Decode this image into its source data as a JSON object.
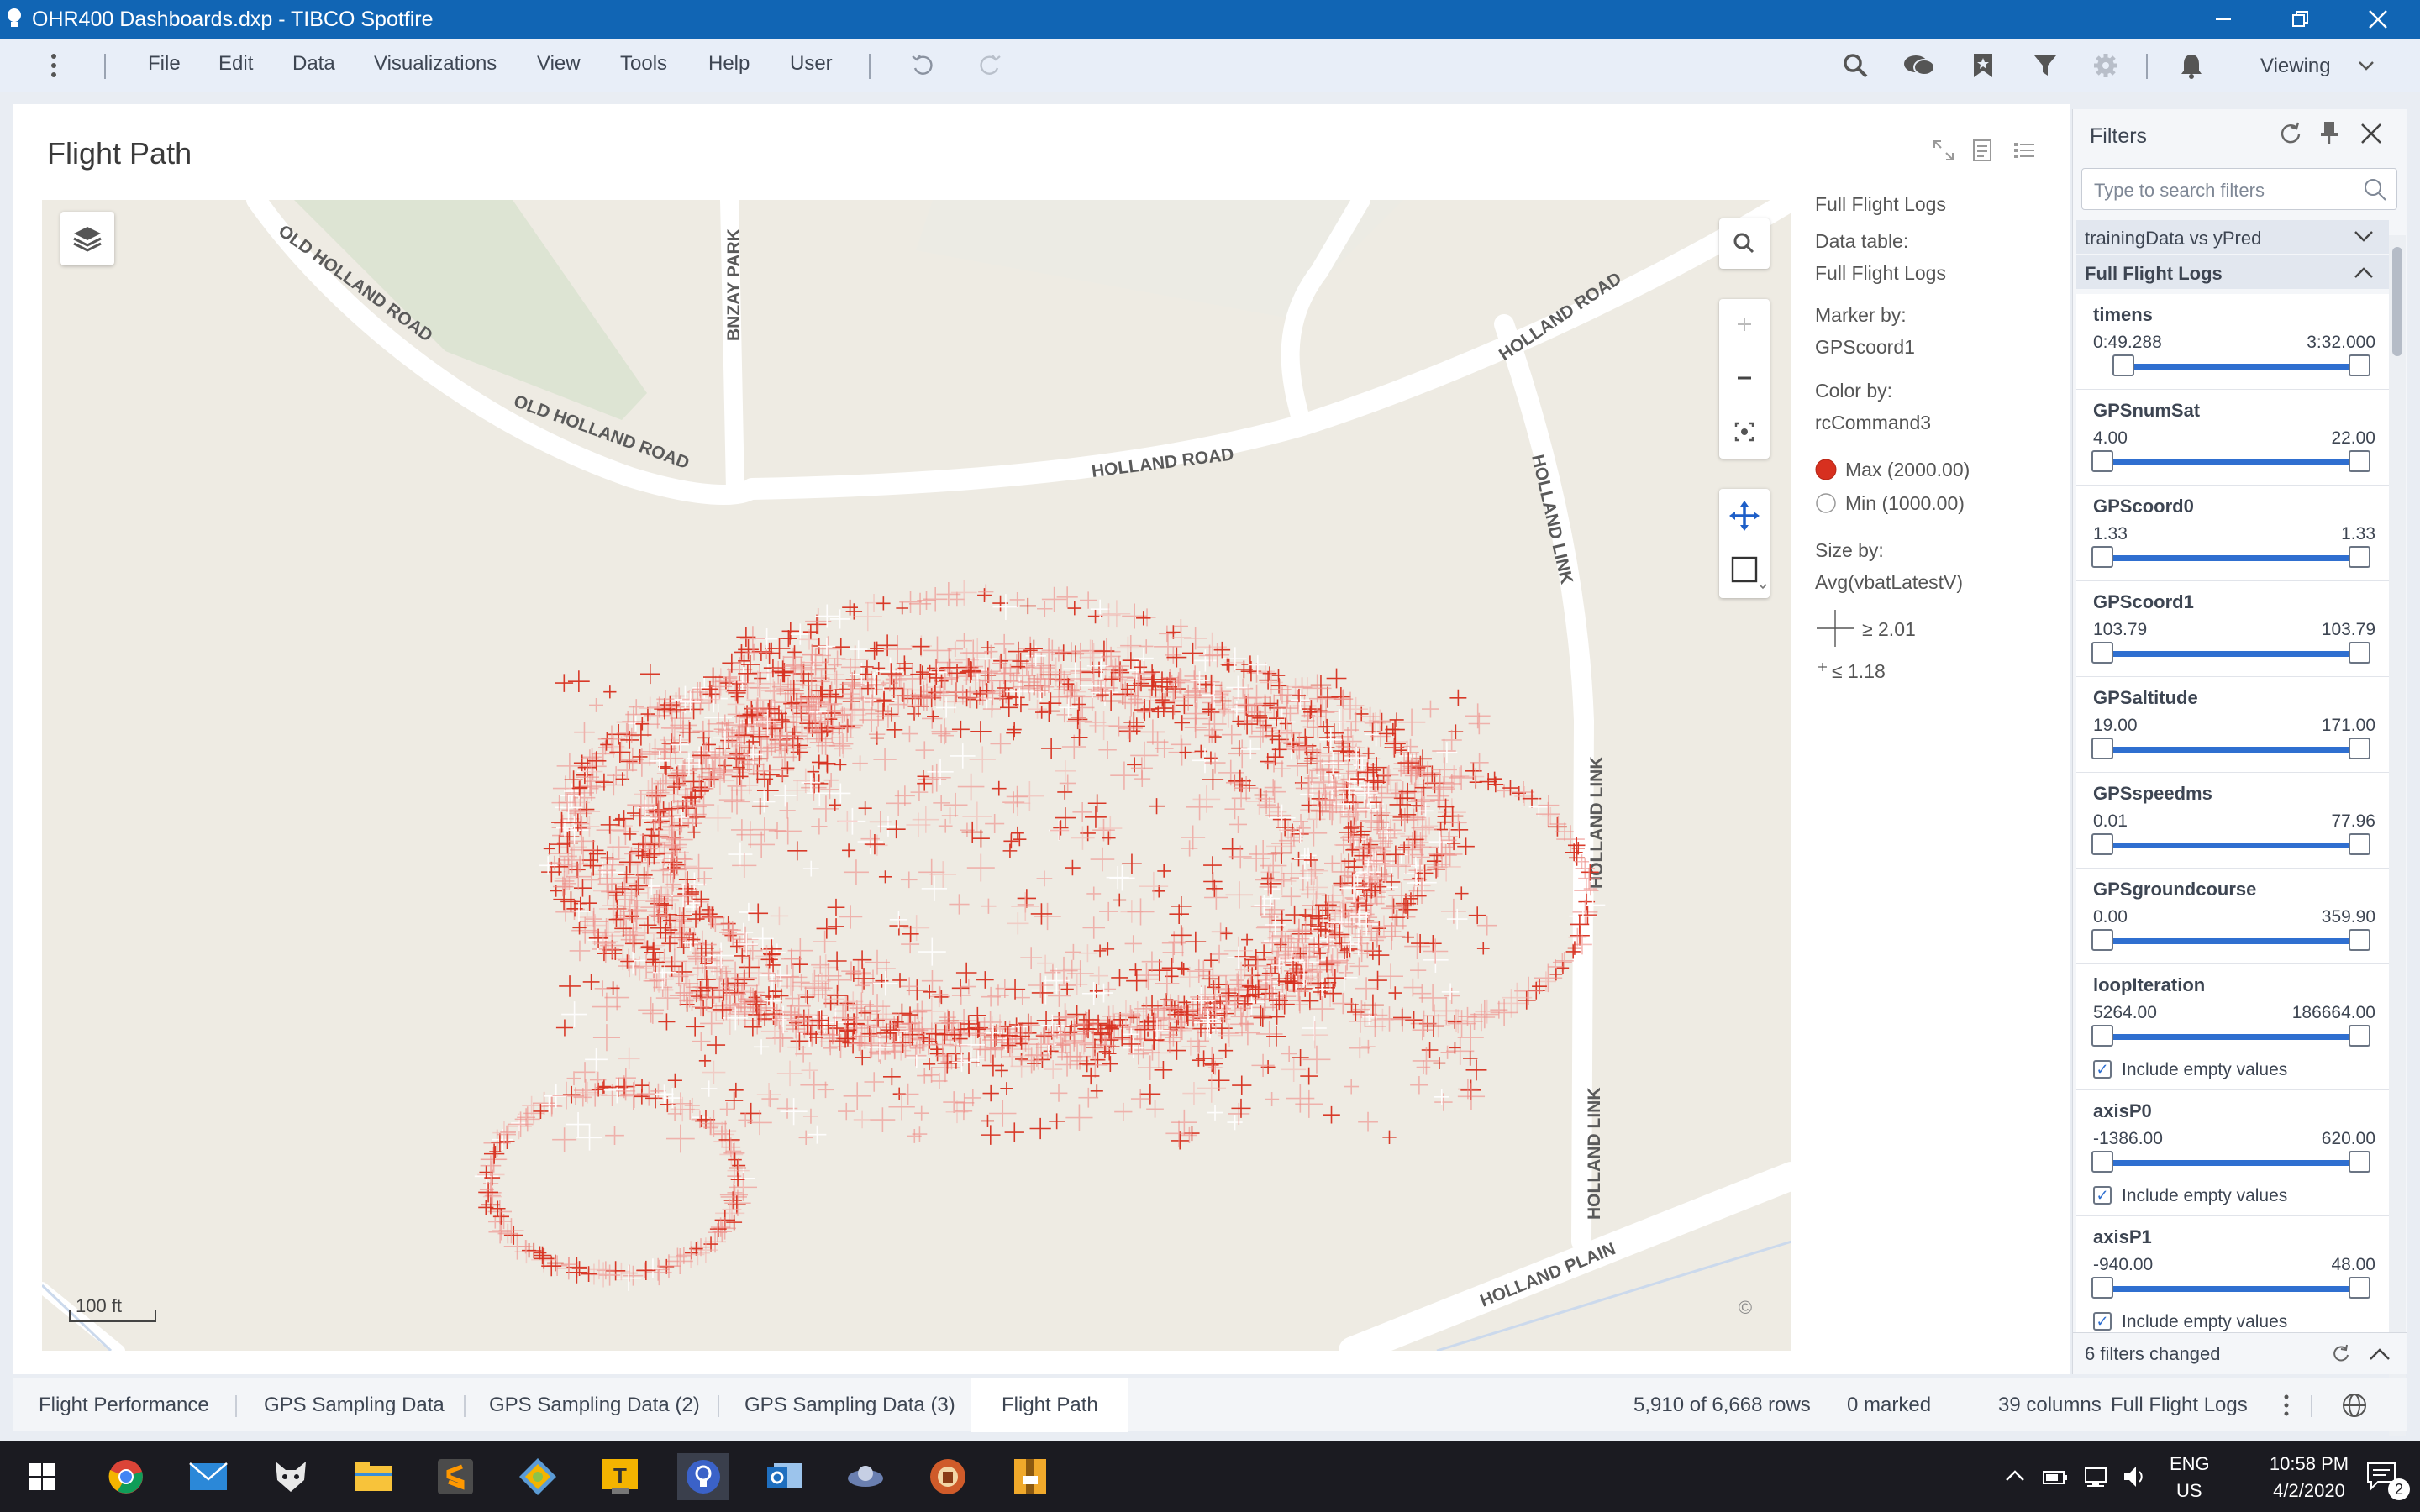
{
  "window": {
    "title": "OHR400 Dashboards.dxp - TIBCO Spotfire",
    "accent": "#1165b4",
    "icons": [
      "app-bulb-icon",
      "minimize-icon",
      "restore-icon",
      "close-icon"
    ]
  },
  "menu": {
    "items": [
      "File",
      "Edit",
      "Data",
      "Visualizations",
      "View",
      "Tools",
      "Help",
      "User"
    ],
    "viewing_mode": "Viewing",
    "icons": [
      "more-vert-icon",
      "undo-icon",
      "redo-icon",
      "search-icon",
      "collaboration-icon",
      "bookmark-icon",
      "filter-icon",
      "settings-icon",
      "notification-icon",
      "chevron-down-icon"
    ]
  },
  "visualization": {
    "title": "Flight Path",
    "header_icons": [
      "maximize-icon",
      "details-icon",
      "legend-list-icon"
    ],
    "map": {
      "streets": [
        "OLD HOLLAND ROAD",
        "OLD HOLLAND ROAD",
        "BNZAY PARK",
        "HOLLAND ROAD",
        "HOLLAND ROAD",
        "HOLLAND LINK",
        "HOLLAND LINK",
        "HOLLAND LINK",
        "HOLLAND PLAIN"
      ],
      "scale_label": "100 ft",
      "copyright_symbol": "©",
      "controls": [
        "layers-icon",
        "map-search-icon",
        "zoom-in-icon",
        "zoom-out-icon",
        "zoom-to-fit-icon",
        "pan-icon",
        "rectangle-select-icon"
      ],
      "marker_colors": {
        "max": "#d7301f",
        "min": "#ffffff"
      }
    },
    "legend": {
      "table_title": "Full Flight Logs",
      "data_table_label": "Data table:",
      "data_table_value": "Full Flight Logs",
      "marker_by_label": "Marker by:",
      "marker_by_value": "GPScoord1",
      "color_by_label": "Color by:",
      "color_by_value": "rcCommand3",
      "color_max": "Max (2000.00)",
      "color_min": "Min (1000.00)",
      "size_by_label": "Size by:",
      "size_by_value": "Avg(vbatLatestV)",
      "size_max": "≥ 2.01",
      "size_min": "≤ 1.18"
    }
  },
  "filters": {
    "title": "Filters",
    "search_placeholder": "Type to search filters",
    "group_collapsed": "trainingData vs yPred",
    "group_expanded": "Full Flight Logs",
    "items": [
      {
        "name": "timens",
        "min": "0:49.288",
        "max": "3:32.000",
        "low_pos": 0.08,
        "include_empty": null
      },
      {
        "name": "GPSnumSat",
        "min": "4.00",
        "max": "22.00",
        "low_pos": 0.0,
        "include_empty": null
      },
      {
        "name": "GPScoord0",
        "min": "1.33",
        "max": "1.33",
        "low_pos": 0.0,
        "include_empty": null
      },
      {
        "name": "GPScoord1",
        "min": "103.79",
        "max": "103.79",
        "low_pos": 0.0,
        "include_empty": null
      },
      {
        "name": "GPSaltitude",
        "min": "19.00",
        "max": "171.00",
        "low_pos": 0.0,
        "include_empty": null
      },
      {
        "name": "GPSspeedms",
        "min": "0.01",
        "max": "77.96",
        "low_pos": 0.0,
        "include_empty": null
      },
      {
        "name": "GPSgroundcourse",
        "min": "0.00",
        "max": "359.90",
        "low_pos": 0.0,
        "include_empty": null
      },
      {
        "name": "loopIteration",
        "min": "5264.00",
        "max": "186664.00",
        "low_pos": 0.0,
        "include_empty": "Include empty values"
      },
      {
        "name": "axisP0",
        "min": "-1386.00",
        "max": "620.00",
        "low_pos": 0.0,
        "include_empty": "Include empty values"
      },
      {
        "name": "axisP1",
        "min": "-940.00",
        "max": "48.00",
        "low_pos": 0.0,
        "include_empty": "Include empty values"
      }
    ],
    "status": "6 filters changed"
  },
  "pages": {
    "tabs": [
      "Flight Performance",
      "GPS Sampling Data",
      "GPS Sampling Data (2)",
      "GPS Sampling Data (3)",
      "Flight Path"
    ],
    "active": "Flight Path"
  },
  "status": {
    "rows": "5,910 of 6,668 rows",
    "marked": "0 marked",
    "columns": "39 columns",
    "table": "Full Flight Logs"
  },
  "taskbar": {
    "apps": [
      "windows-start-icon",
      "chrome-icon",
      "mail-icon",
      "fox-app-icon",
      "file-explorer-icon",
      "sublime-text-icon",
      "git-icon",
      "text-app-icon",
      "spotfire-icon",
      "outlook-icon",
      "satellite-app-icon",
      "game-app-icon",
      "archive-app-icon"
    ],
    "language": "ENG",
    "region": "US",
    "time": "10:58 PM",
    "date": "4/2/2020",
    "notifications": "2"
  }
}
